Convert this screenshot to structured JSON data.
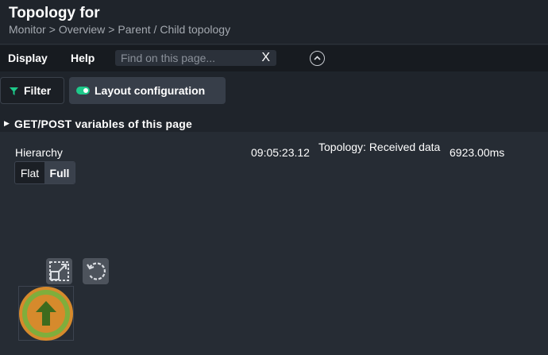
{
  "header": {
    "title": "Topology for",
    "breadcrumb": [
      "Monitor",
      "Overview",
      "Parent / Child topology"
    ],
    "breadcrumb_sep": ">"
  },
  "menu": {
    "display_label": "Display",
    "help_label": "Help",
    "search_placeholder": "Find on this page...",
    "search_value": "",
    "clear_symbol": "X"
  },
  "toolbar": {
    "filter_label": "Filter",
    "layout_label": "Layout configuration"
  },
  "vars": {
    "label": "GET/POST variables of this page",
    "arrow": "▶"
  },
  "hierarchy": {
    "label": "Hierarchy",
    "options": [
      "Flat",
      "Full"
    ],
    "selected": "Full"
  },
  "log": {
    "time": "09:05:23.12",
    "message": "Topology: Received data",
    "duration": "6923.00ms"
  },
  "node": {
    "icon": "up-arrow-icon",
    "state_color": "#7fae3c",
    "ring_color": "#d68a2c"
  },
  "colors": {
    "accent": "#1ec98a",
    "background": "#1f242b",
    "content_background": "#262c34"
  }
}
